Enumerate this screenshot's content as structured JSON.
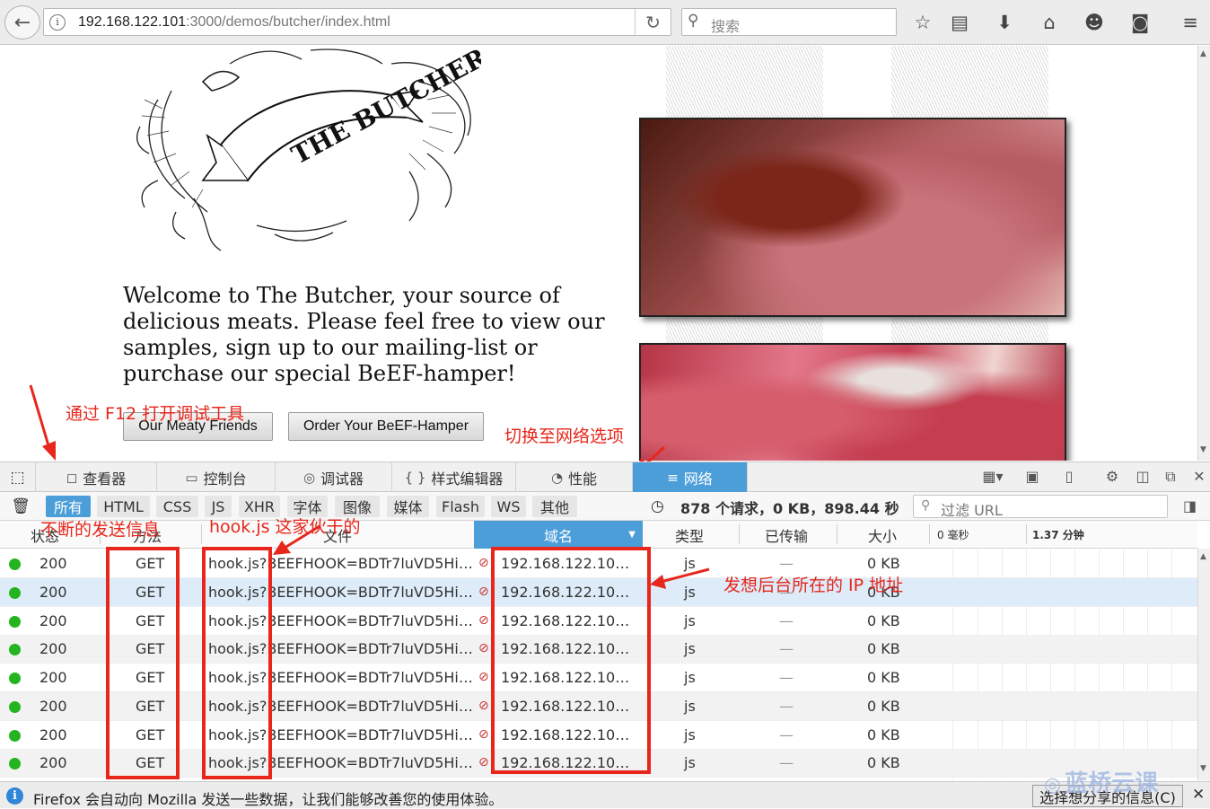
{
  "browser": {
    "url_host": "192.168.122.101",
    "url_path": ":3000/demos/butcher/index.html",
    "info_icon": "i",
    "search_placeholder": "搜索"
  },
  "page": {
    "welcome_text": "Welcome to The Butcher, your source of delicious meats. Please feel free to view our samples, sign up to our mailing-list or purchase our special BeEF-hamper!",
    "button_friends": "Our Meaty Friends",
    "button_hamper": "Order Your BeEF-Hamper",
    "logo_text": "THE BUTCHER"
  },
  "annotations": {
    "f12": "通过 F12 打开调试工具",
    "switch_net": "切换至网络选项",
    "sending": "不断的发送信息",
    "hookjs": "hook.js 这家伙干的",
    "ip": "发想后台所在的 IP 地址"
  },
  "devtools": {
    "tabs": [
      {
        "icon": "◻",
        "label": "查看器"
      },
      {
        "icon": "▭",
        "label": "控制台"
      },
      {
        "icon": "◎",
        "label": "调试器"
      },
      {
        "icon": "{ }",
        "label": "样式编辑器"
      },
      {
        "icon": "◔",
        "label": "性能"
      },
      {
        "icon": "≡",
        "label": "网络"
      }
    ],
    "filters": [
      "所有",
      "HTML",
      "CSS",
      "JS",
      "XHR",
      "字体",
      "图像",
      "媒体",
      "Flash",
      "WS",
      "其他"
    ],
    "summary": "878 个请求，0 KB，898.44 秒",
    "url_filter_placeholder": "过滤 URL",
    "columns": [
      "状态",
      "方法",
      "文件",
      "域名",
      "类型",
      "已传输",
      "大小",
      "0 毫秒",
      "1.37 分钟"
    ],
    "rows": [
      {
        "status": "200",
        "method": "GET",
        "file": "hook.js?BEEFHOOK=BDTr7luVD5Hi…",
        "domain": "192.168.122.10…",
        "type": "js",
        "transferred": "—",
        "size": "0 KB"
      },
      {
        "status": "200",
        "method": "GET",
        "file": "hook.js?BEEFHOOK=BDTr7luVD5Hi…",
        "domain": "192.168.122.10…",
        "type": "js",
        "transferred": "—",
        "size": "0 KB"
      },
      {
        "status": "200",
        "method": "GET",
        "file": "hook.js?BEEFHOOK=BDTr7luVD5Hi…",
        "domain": "192.168.122.10…",
        "type": "js",
        "transferred": "—",
        "size": "0 KB"
      },
      {
        "status": "200",
        "method": "GET",
        "file": "hook.js?BEEFHOOK=BDTr7luVD5Hi…",
        "domain": "192.168.122.10…",
        "type": "js",
        "transferred": "—",
        "size": "0 KB"
      },
      {
        "status": "200",
        "method": "GET",
        "file": "hook.js?BEEFHOOK=BDTr7luVD5Hi…",
        "domain": "192.168.122.10…",
        "type": "js",
        "transferred": "—",
        "size": "0 KB"
      },
      {
        "status": "200",
        "method": "GET",
        "file": "hook.js?BEEFHOOK=BDTr7luVD5Hi…",
        "domain": "192.168.122.10…",
        "type": "js",
        "transferred": "—",
        "size": "0 KB"
      },
      {
        "status": "200",
        "method": "GET",
        "file": "hook.js?BEEFHOOK=BDTr7luVD5Hi…",
        "domain": "192.168.122.10…",
        "type": "js",
        "transferred": "—",
        "size": "0 KB"
      },
      {
        "status": "200",
        "method": "GET",
        "file": "hook.js?BEEFHOOK=BDTr7luVD5Hi…",
        "domain": "192.168.122.10…",
        "type": "js",
        "transferred": "—",
        "size": "0 KB"
      }
    ]
  },
  "notification": {
    "icon": "i",
    "text": "Firefox 会自动向 Mozilla 发送一些数据，让我们能够改善您的使用体验。",
    "button": "选择想分享的信息(C)",
    "close": "✕"
  },
  "watermark": "蓝桥云课",
  "colors": {
    "accent": "#4c9ed9",
    "annotation": "#e8261b",
    "status_ok": "#24b41f"
  }
}
